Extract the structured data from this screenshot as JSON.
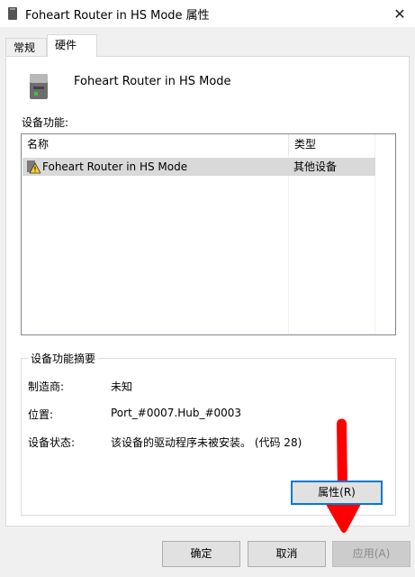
{
  "window": {
    "title": "Foheart Router in HS Mode 属性",
    "close_label": "✕"
  },
  "tabs": [
    {
      "label": "常规",
      "active": false
    },
    {
      "label": "硬件",
      "active": true
    }
  ],
  "device": {
    "name": "Foheart Router in HS Mode",
    "icon": "usb-device-icon"
  },
  "functions": {
    "label": "设备功能:",
    "columns": [
      "名称",
      "类型"
    ],
    "rows": [
      {
        "name": "Foheart Router in HS Mode",
        "type": "其他设备",
        "icon": "warning-icon",
        "selected": true
      }
    ]
  },
  "summary": {
    "title": "设备功能摘要",
    "manufacturer_label": "制造商:",
    "manufacturer_value": "未知",
    "location_label": "位置:",
    "location_value": "Port_#0007.Hub_#0003",
    "status_label": "设备状态:",
    "status_value": "该设备的驱动程序未被安装。 (代码 28)",
    "properties_button": "属性(R)"
  },
  "annotation": {
    "icon": "red-arrow-pointer",
    "color": "#ff0000"
  },
  "buttons": {
    "ok": "确定",
    "cancel": "取消",
    "apply": "应用(A)"
  },
  "colors": {
    "accent": "#0078d7",
    "selection": "#d9d9d9"
  }
}
